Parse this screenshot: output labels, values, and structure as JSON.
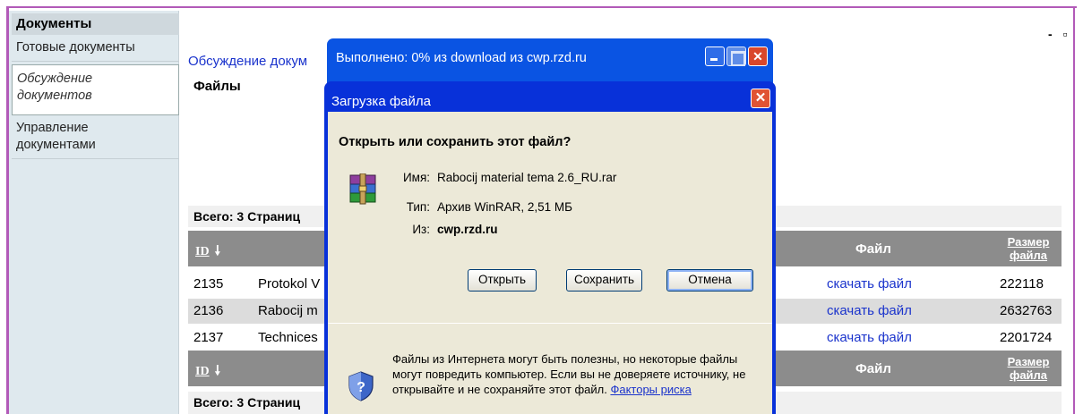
{
  "sidebar": {
    "heading": "Документы",
    "items": [
      {
        "label": "Готовые документы"
      },
      {
        "label_line1": "Обсуждение",
        "label_line2": "документов",
        "selected": true
      },
      {
        "label_line1": "Управление",
        "label_line2": "документами"
      }
    ]
  },
  "window_controls": {
    "text": "- ▫"
  },
  "main": {
    "breadcrumb": "Обсуждение докум",
    "files_heading": "Файлы",
    "summary_top": "Всего: 3   Страниц",
    "summary_bottom": "Всего: 3   Страниц",
    "table": {
      "headers": {
        "id": "ID",
        "id_arrow": "🠗",
        "file": "Файл",
        "size_line1": "Размер",
        "size_line2": "файла"
      },
      "rows": [
        {
          "id": "2135",
          "name": "Protokol V",
          "link": "скачать файл",
          "size": "222118"
        },
        {
          "id": "2136",
          "name": "Rabocij m",
          "link": "скачать файл",
          "size": "2632763"
        },
        {
          "id": "2137",
          "name": "Technices",
          "link": "скачать файл",
          "size": "2201724"
        }
      ]
    }
  },
  "progress_dialog": {
    "title": "Выполнено: 0% из download из cwp.rzd.ru",
    "close_glyph": "✕"
  },
  "download_dialog": {
    "title": "Загрузка файла",
    "close_glyph": "✕",
    "question": "Открыть или сохранить этот файл?",
    "name_label": "Имя:",
    "name_value": "Rabocij material tema 2.6_RU.rar",
    "type_label": "Тип:",
    "type_value": "Архив WinRAR, 2,51 МБ",
    "from_label": "Из:",
    "from_value": "cwp.rzd.ru",
    "buttons": {
      "open": "Открыть",
      "save": "Сохранить",
      "cancel": "Отмена"
    },
    "warning_line1": "Файлы из Интернета могут быть полезны, но некоторые файлы",
    "warning_line2": "могут повредить компьютер. Если вы не доверяете источнику, не",
    "warning_line3": "открывайте и не сохраняйте этот файл.",
    "risk_link": "Факторы риска"
  },
  "colors": {
    "xp_title_blue": "#0831d9",
    "table_header": "#8c8c8c",
    "link_blue": "#1a33cc",
    "frame_purple": "#b25ab8"
  },
  "icons": [
    "winrar-archive-icon",
    "security-shield-icon",
    "sort-down-arrow-icon",
    "close-icon",
    "minimize-icon",
    "maximize-icon"
  ]
}
